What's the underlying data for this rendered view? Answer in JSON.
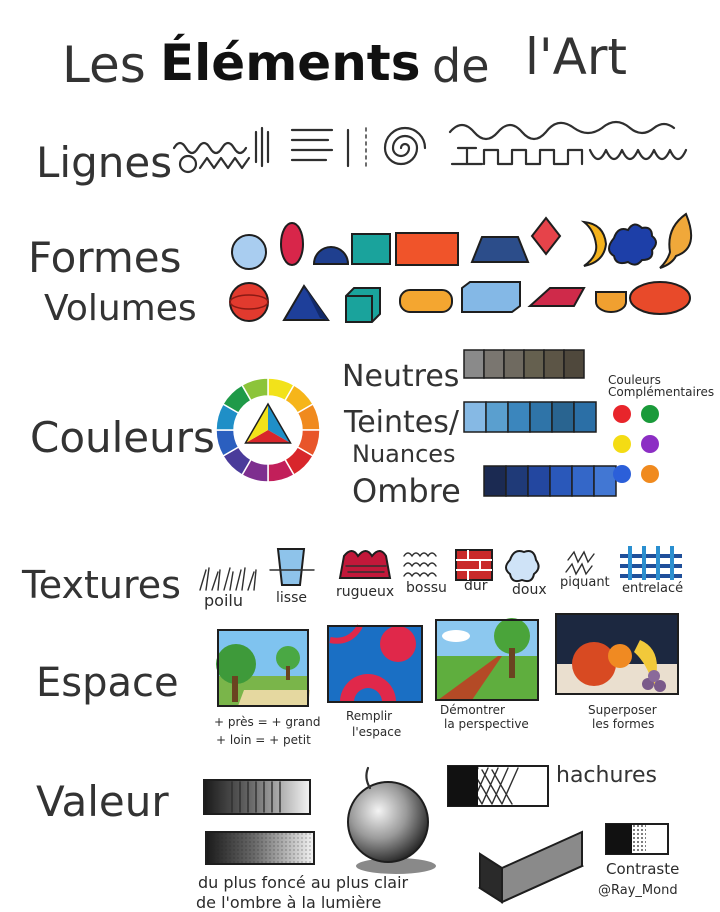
{
  "title": {
    "part1": "Les",
    "part2": "Éléments",
    "part3": "de",
    "part4": "l'Art"
  },
  "rows": {
    "lignes": "Lignes",
    "formes": "Formes",
    "volumes": "Volumes",
    "couleurs": "Couleurs",
    "textures": "Textures",
    "espace": "Espace",
    "valeur": "Valeur"
  },
  "colors": {
    "neutres": "Neutres",
    "teintes": "Teintes/",
    "nuances": "Nuances",
    "ombre": "Ombre",
    "complementaires_1": "Couleurs",
    "complementaires_2": "Complémentaires",
    "neutral_swatches": [
      "#8a8a8a",
      "#7a7670",
      "#6f6a60",
      "#65604f",
      "#5c5546",
      "#4f483c"
    ],
    "tint_swatches": [
      "#86b9e4",
      "#5a9fcf",
      "#3b86bd",
      "#2f74a8",
      "#296490",
      "#2b6fa6"
    ],
    "shade_swatches": [
      "#1b2a52",
      "#1f3a78",
      "#2347a0",
      "#2a58ba",
      "#3467c8",
      "#4277d3"
    ],
    "complementary_dots": [
      "#e8252b",
      "#1a9a3a",
      "#f4dc14",
      "#8c2ec4",
      "#2b5fd9",
      "#f08a1e"
    ],
    "wheel": [
      "#f2e21a",
      "#f6b51a",
      "#f08a1e",
      "#e8552a",
      "#d8262b",
      "#c21f5a",
      "#7e2f8f",
      "#4a3b9a",
      "#2b5fbf",
      "#1f8fc7",
      "#1f9a48",
      "#8cc43a"
    ]
  },
  "textures": {
    "poilu": "poilu",
    "lisse": "lisse",
    "rugueux": "rugueux",
    "bossu": "bossu",
    "dur": "dur",
    "doux": "doux",
    "piquant": "piquant",
    "entrelace": "entrelacé"
  },
  "espace": {
    "cap1_line1": "+ près = + grand",
    "cap1_line2": "+ loin = + petit",
    "cap2_line1": "Remplir",
    "cap2_line2": "l'espace",
    "cap3_line1": "Démontrer",
    "cap3_line2": "la perspective",
    "cap4_line1": "Superposer",
    "cap4_line2": "les formes"
  },
  "valeur": {
    "hachures": "hachures",
    "gradient_line1": "du plus foncé au plus clair",
    "gradient_line2": "de l'ombre à la lumière",
    "contraste": "Contraste",
    "watermark": "@Ray_Mond"
  }
}
